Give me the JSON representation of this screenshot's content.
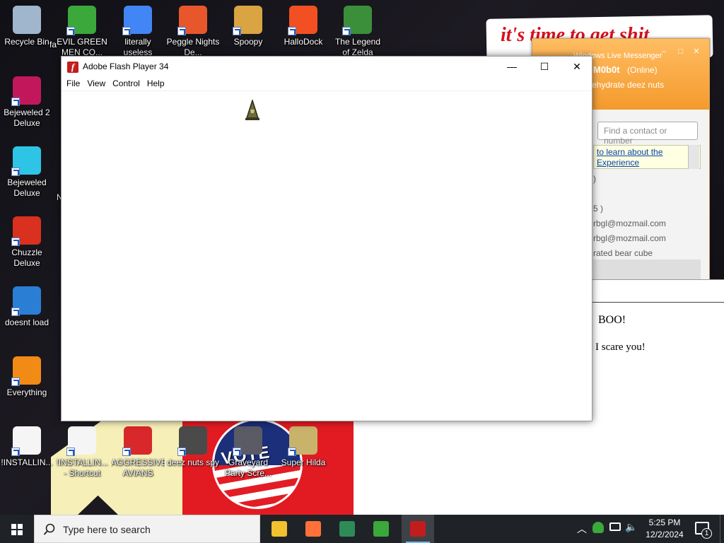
{
  "desktop": {
    "wallpaper_text": "it's time to get shit",
    "vote_badge_text": "VOTE",
    "icons": [
      {
        "label": "Recycle Bin",
        "color": "#9fb6cc"
      },
      {
        "label": "EVIL GREEN MEN CO...",
        "color": "#3aa83a"
      },
      {
        "label": "literally useless",
        "color": "#4285f4"
      },
      {
        "label": "Peggle Nights De...",
        "color": "#e8572c"
      },
      {
        "label": "Spoopy",
        "color": "#d9a441"
      },
      {
        "label": "HalloDock",
        "color": "#f25022"
      },
      {
        "label": "The Legend of Zelda",
        "color": "#3b8f3b"
      },
      {
        "label": "Bejeweled 2 Deluxe",
        "color": "#c2185b"
      },
      {
        "label": "Bejeweled Deluxe",
        "color": "#2ec4e6"
      },
      {
        "label": "Chuzzle Deluxe",
        "color": "#d9301f"
      },
      {
        "label": "doesnt load",
        "color": "#2a7fd4"
      },
      {
        "label": "Everything",
        "color": "#f28a16"
      },
      {
        "label": "!INSTALLIN...",
        "color": "#f5f5f5"
      },
      {
        "label": "!INSTALLIN... - Shortcut",
        "color": "#f5f5f5"
      },
      {
        "label": "AGGRESSIVE AVIANS",
        "color": "#d8282c"
      },
      {
        "label": "deez nuts spy",
        "color": "#4a4a4a"
      },
      {
        "label": "Graveyard Party Scre...",
        "color": "#5b5b66"
      },
      {
        "label": "Super Hilda",
        "color": "#c9b26a"
      }
    ],
    "partial_labels": {
      "fa": "fa",
      "n": "N"
    }
  },
  "messenger": {
    "title": "Windows Live Messenger",
    "user": "M0b0t",
    "status": "(Online)",
    "mood": "ehydrate deez nuts",
    "search_placeholder": "Find a contact or number",
    "info_line1": "to learn about the",
    "info_line2": "Experience",
    "contacts": [
      ")",
      "",
      "5 )",
      "rbgl@mozmail.com",
      "rbgl@mozmail.com",
      "rated bear cube"
    ]
  },
  "boo_window": {
    "line1": "BOO!",
    "line2": "I scare you!"
  },
  "flash": {
    "title": "Adobe Flash Player 34",
    "menu": [
      "File",
      "View",
      "Control",
      "Help"
    ],
    "minimize": "—",
    "maximize": "☐",
    "close": "✕"
  },
  "taskbar": {
    "search_placeholder": "Type here to search",
    "apps": [
      {
        "name": "file-explorer",
        "color": "#f2c12e"
      },
      {
        "name": "firefox",
        "color": "#ff7139"
      },
      {
        "name": "app-window",
        "color": "#2e8b57"
      },
      {
        "name": "messenger",
        "color": "#3aa83a"
      },
      {
        "name": "flash-player",
        "color": "#c21d1d"
      }
    ],
    "time": "5:25 PM",
    "date": "12/2/2024",
    "notifications": "1"
  }
}
